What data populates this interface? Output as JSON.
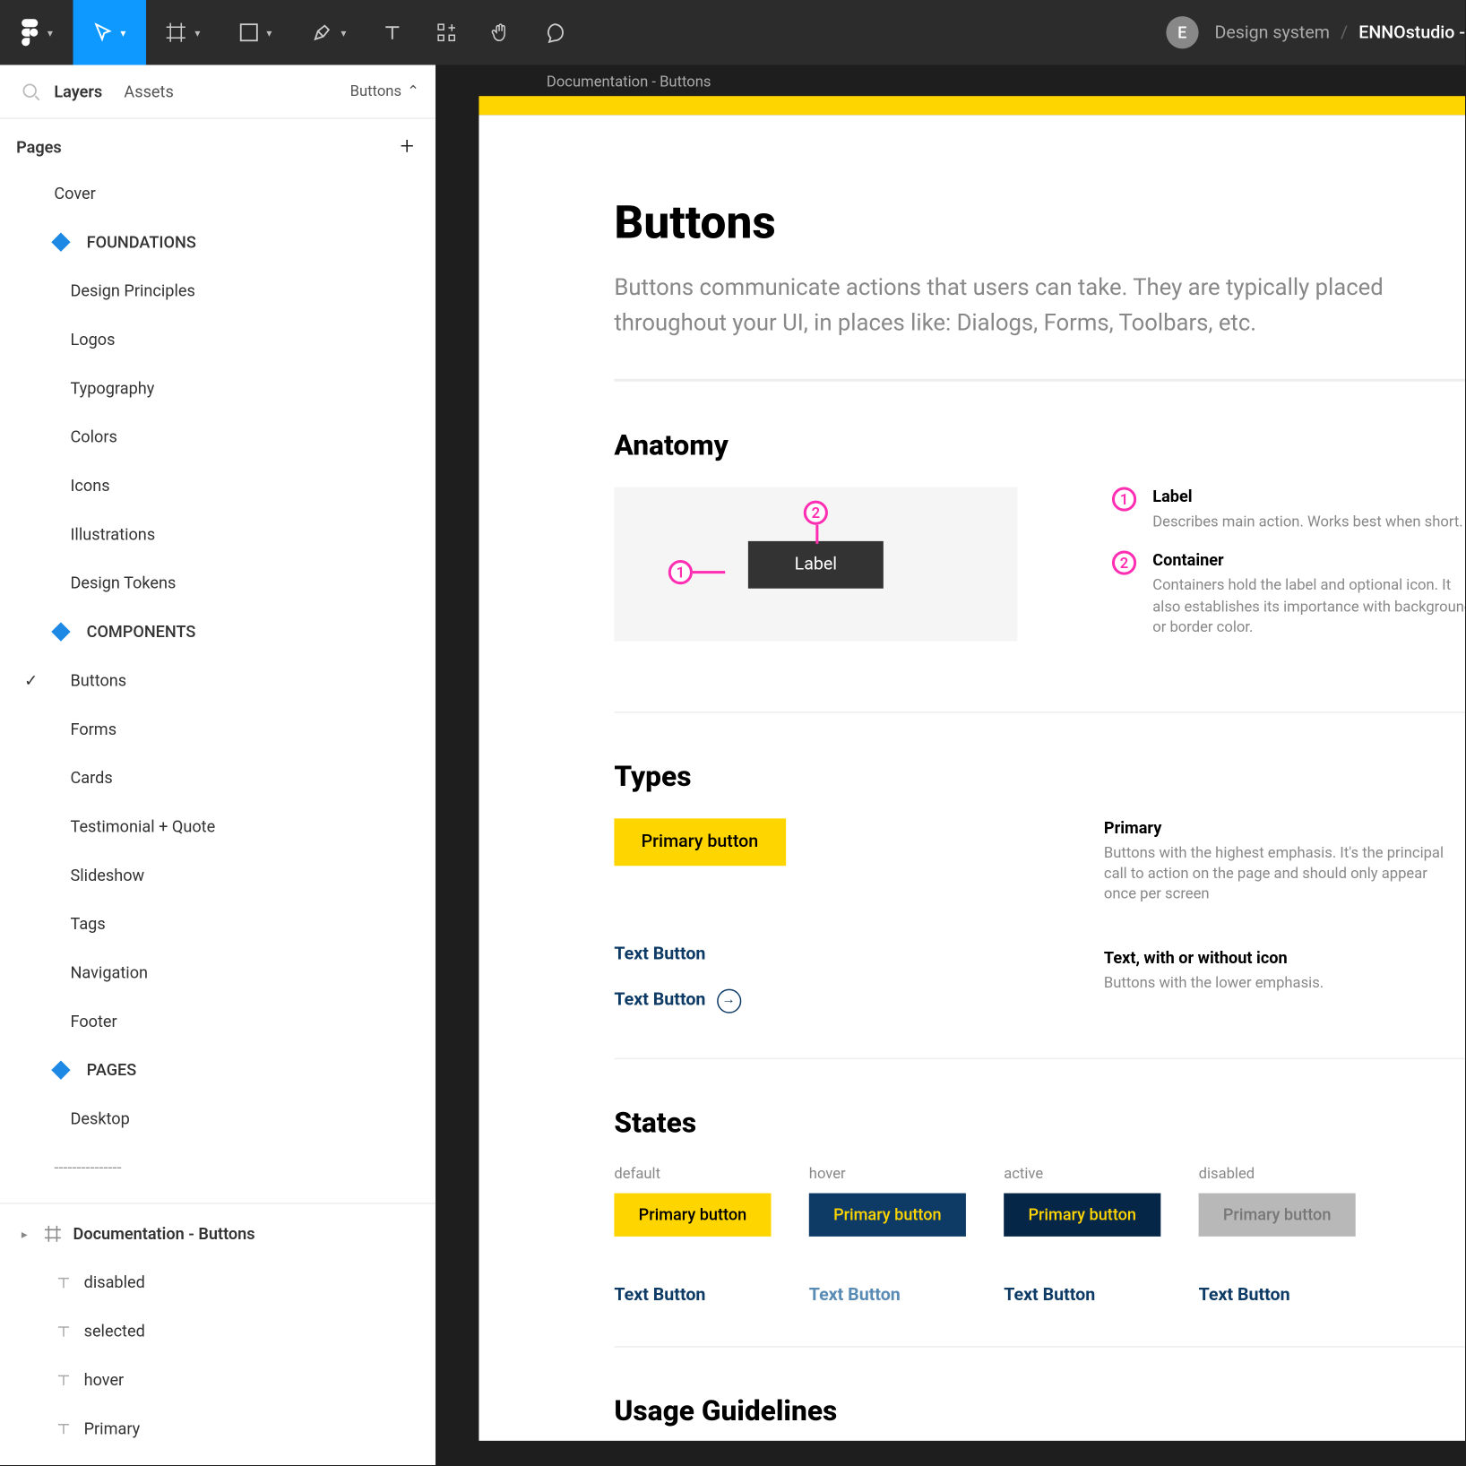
{
  "topbar": {
    "avatar_initial": "E",
    "project_label": "Design system",
    "file_label": "ENNOstudio -"
  },
  "sidebar": {
    "tabs": {
      "layers": "Layers",
      "assets": "Assets"
    },
    "page_dropdown_label": "Buttons",
    "pages_title": "Pages",
    "pages": [
      {
        "kind": "page",
        "label": "Cover"
      },
      {
        "kind": "sectionDiamond",
        "label": "FOUNDATIONS"
      },
      {
        "kind": "sub",
        "label": "Design Principles"
      },
      {
        "kind": "sub",
        "label": "Logos"
      },
      {
        "kind": "sub",
        "label": "Typography"
      },
      {
        "kind": "sub",
        "label": "Colors"
      },
      {
        "kind": "sub",
        "label": "Icons"
      },
      {
        "kind": "sub",
        "label": "Illustrations"
      },
      {
        "kind": "sub",
        "label": "Design Tokens"
      },
      {
        "kind": "sectionDiamond",
        "label": "COMPONENTS"
      },
      {
        "kind": "sub",
        "label": "Buttons",
        "active": true
      },
      {
        "kind": "sub",
        "label": "Forms"
      },
      {
        "kind": "sub",
        "label": "Cards"
      },
      {
        "kind": "sub",
        "label": "Testimonial + Quote"
      },
      {
        "kind": "sub",
        "label": "Slideshow"
      },
      {
        "kind": "sub",
        "label": "Tags"
      },
      {
        "kind": "sub",
        "label": "Navigation"
      },
      {
        "kind": "sub",
        "label": "Footer"
      },
      {
        "kind": "sectionDiamond",
        "label": "PAGES"
      },
      {
        "kind": "sub",
        "label": "Desktop"
      },
      {
        "kind": "dashes",
        "label": "---------------"
      }
    ],
    "layers": {
      "frame": "Documentation - Buttons",
      "items": [
        "disabled",
        "selected",
        "hover",
        "Primary"
      ]
    }
  },
  "canvas": {
    "frame_label": "Documentation - Buttons",
    "title": "Buttons",
    "subtitle": "Buttons communicate actions that users can take. They are typically placed throughout your UI, in places like: Dialogs, Forms, Toolbars, etc.",
    "anatomy": {
      "heading": "Anatomy",
      "sample_label": "Label",
      "pin_1": "1",
      "pin_2": "2",
      "legend": [
        {
          "num": "1",
          "title": "Label",
          "desc": "Describes main action. Works best when short."
        },
        {
          "num": "2",
          "title": "Container",
          "desc": "Containers hold the label and optional icon. It also establishes its importance with background or border color."
        }
      ]
    },
    "types": {
      "heading": "Types",
      "primary_btn": "Primary button",
      "text_btn_1": "Text Button",
      "text_btn_2": "Text Button",
      "primary_title": "Primary",
      "primary_desc": "Buttons with the highest emphasis. It's the principal call to action on the page and should only appear once per screen",
      "text_title": "Text, with or without icon",
      "text_desc": "Buttons with the lower emphasis."
    },
    "states": {
      "heading": "States",
      "cols": [
        {
          "label": "default",
          "primary": "Primary button",
          "text": "Text Button"
        },
        {
          "label": "hover",
          "primary": "Primary button",
          "text": "Text Button"
        },
        {
          "label": "active",
          "primary": "Primary button",
          "text": "Text Button"
        },
        {
          "label": "disabled",
          "primary": "Primary button",
          "text": "Text Button"
        }
      ]
    },
    "usage_heading": "Usage Guidelines"
  }
}
